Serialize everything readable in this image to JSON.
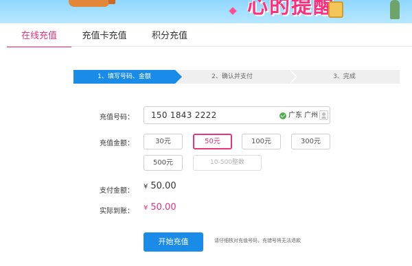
{
  "banner": {
    "logo_text": "心的提醒"
  },
  "tabs": [
    {
      "label": "在线充值",
      "active": true
    },
    {
      "label": "充值卡充值",
      "active": false
    },
    {
      "label": "积分充值",
      "active": false
    }
  ],
  "steps": [
    {
      "label": "1、填写号码、金额",
      "state": "current"
    },
    {
      "label": "2、确认并支付",
      "state": "pending"
    },
    {
      "label": "3、完成",
      "state": "pending"
    }
  ],
  "form": {
    "number_label": "充值号码：",
    "number_value": "150 1843 2222",
    "region": "广东 广州",
    "amount_label": "充值金额：",
    "amounts": [
      "30元",
      "50元",
      "100元",
      "300元",
      "500元"
    ],
    "selected_amount": "50元",
    "custom_placeholder": "10-500整数",
    "pay_label": "支付金额：",
    "pay_value": "50.00",
    "actual_label": "实际到账：",
    "actual_value": "50.00",
    "currency": "¥",
    "submit_label": "开始充值",
    "hint": "请仔细核对充值号码，充错号将无法退款"
  },
  "colors": {
    "accent_pink": "#e6337a",
    "primary_blue": "#1a8be6",
    "success_green": "#4cae4c"
  }
}
